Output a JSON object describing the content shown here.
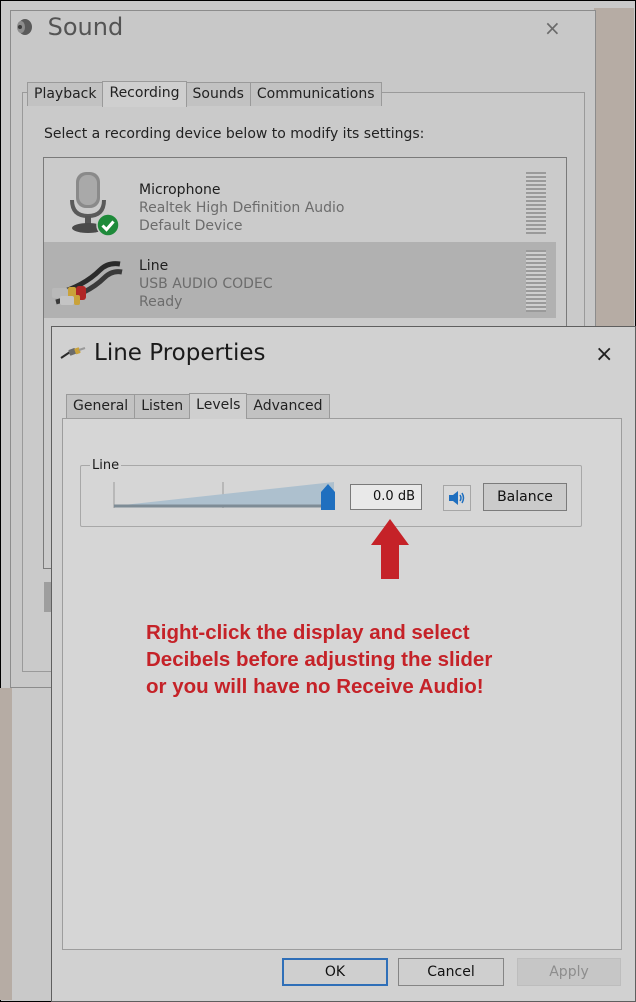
{
  "sound_window": {
    "title": "Sound",
    "close_glyph": "×",
    "tabs": [
      {
        "label": "Playback",
        "active": false
      },
      {
        "label": "Recording",
        "active": true
      },
      {
        "label": "Sounds",
        "active": false
      },
      {
        "label": "Communications",
        "active": false
      }
    ],
    "instruction": "Select a recording device below to modify its settings:",
    "devices": [
      {
        "name": "Microphone",
        "driver": "Realtek High Definition Audio",
        "status": "Default Device",
        "icon": "microphone-icon",
        "default": true
      },
      {
        "name": "Line",
        "driver": "USB AUDIO  CODEC",
        "status": "Ready",
        "icon": "rca-cable-icon",
        "selected": true
      }
    ]
  },
  "line_properties": {
    "title": "Line Properties",
    "close_glyph": "×",
    "tabs": [
      {
        "label": "General",
        "active": false
      },
      {
        "label": "Listen",
        "active": false
      },
      {
        "label": "Levels",
        "active": true
      },
      {
        "label": "Advanced",
        "active": false
      }
    ],
    "group_label": "Line",
    "level_display": "0.0 dB",
    "slider_level": 1.0,
    "balance_label": "Balance",
    "annotation_lines": [
      "Right-click the display and select",
      "Decibels before adjusting the slider",
      "or you will have no Receive Audio!"
    ],
    "buttons": {
      "ok": "OK",
      "cancel": "Cancel",
      "apply": "Apply"
    }
  },
  "colors": {
    "annotation": "#c52228",
    "slider_thumb": "#1f6fbf",
    "check_badge": "#1e8a3a"
  }
}
